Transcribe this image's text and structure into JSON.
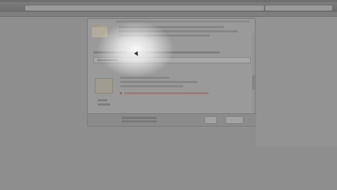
{
  "browser": {
    "bookmarks": [
      "",
      ""
    ]
  },
  "dialog": {
    "title": "",
    "buttons": {
      "ok_label": "",
      "cancel_label": ""
    }
  }
}
